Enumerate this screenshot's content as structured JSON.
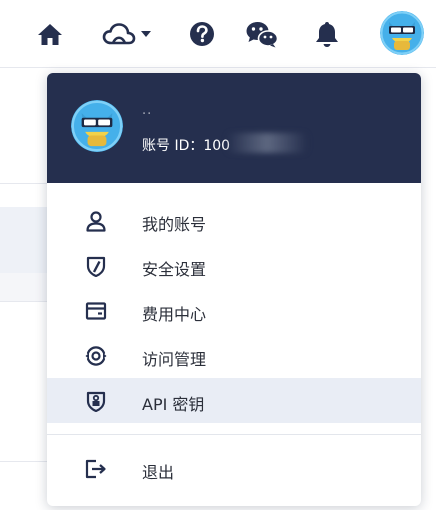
{
  "topbar": {
    "icons": [
      "home-icon",
      "cloud-icon",
      "help-icon",
      "wechat-icon",
      "bell-icon"
    ]
  },
  "dropdown": {
    "header": {
      "username": "..",
      "account_id": "账号 ID：100"
    },
    "items": [
      {
        "label": "我的账号",
        "icon": "user-icon"
      },
      {
        "label": "安全设置",
        "icon": "shield-icon"
      },
      {
        "label": "费用中心",
        "icon": "wallet-icon"
      },
      {
        "label": "访问管理",
        "icon": "access-icon"
      },
      {
        "label": "API 密钥",
        "icon": "key-shield-icon"
      }
    ],
    "logout": {
      "label": "退出",
      "icon": "logout-icon"
    }
  },
  "colors": {
    "header_bg": "#252f4e",
    "active_item_bg": "#e9edf5",
    "icon_dark": "#252f4e",
    "avatar_bg": "#45b0ea"
  }
}
